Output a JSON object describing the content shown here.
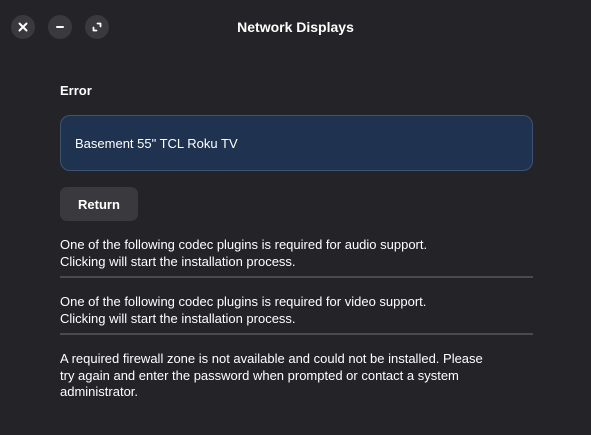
{
  "window": {
    "title": "Network Displays",
    "controls": [
      {
        "name": "close-icon"
      },
      {
        "name": "minimize-icon"
      },
      {
        "name": "maximize-icon"
      }
    ]
  },
  "main": {
    "heading": "Error",
    "device_name": "Basement 55\" TCL Roku TV",
    "return_label": "Return",
    "messages": [
      {
        "line1": "One of the following codec plugins is required for audio support.",
        "line2": "Clicking will start the installation process."
      },
      {
        "line1": "One of the following codec plugins is required for video support.",
        "line2": "Clicking will start the installation process."
      },
      {
        "line1": "A required firewall zone is not available and could not be installed. Please",
        "line2": "try again and enter the password when prompted or contact a system",
        "line3": "administrator."
      }
    ]
  },
  "colors": {
    "background": "#242428",
    "device_box": "#1f3350",
    "button": "#3a3a3e",
    "separator": "#4a4a4f"
  }
}
